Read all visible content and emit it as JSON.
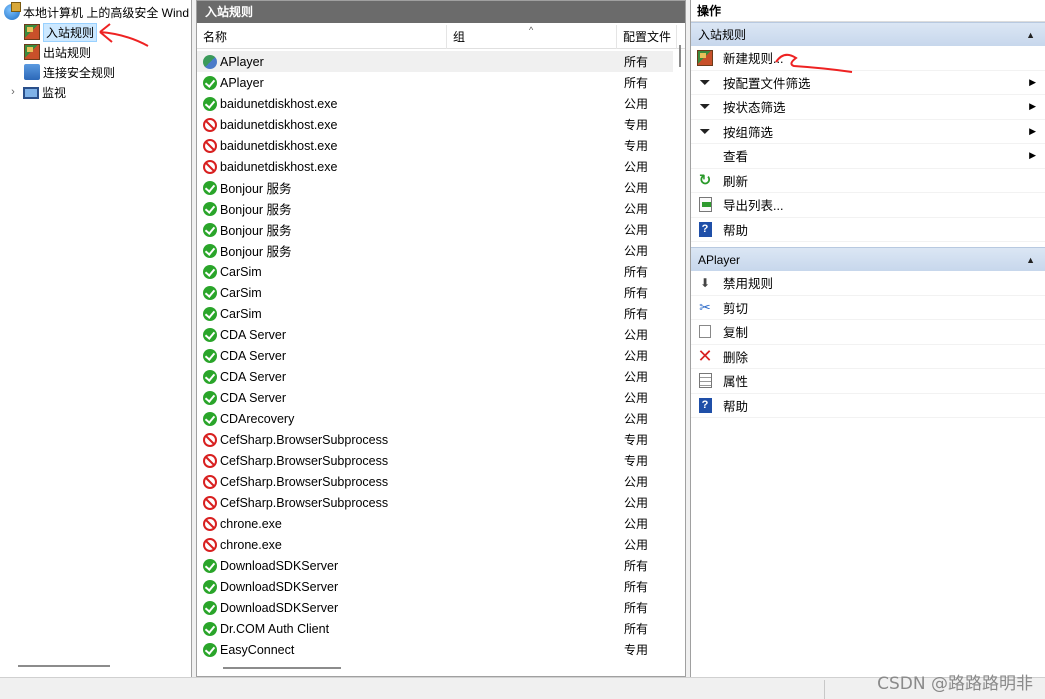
{
  "tree": {
    "root": "本地计算机 上的高级安全 Wind",
    "items": [
      {
        "label": "入站规则",
        "icon": "inbound-rules-icon",
        "selected": true
      },
      {
        "label": "出站规则",
        "icon": "outbound-rules-icon",
        "selected": false
      },
      {
        "label": "连接安全规则",
        "icon": "connection-security-icon",
        "selected": false
      },
      {
        "label": "监视",
        "icon": "monitor-icon",
        "selected": false
      }
    ]
  },
  "list": {
    "title": "入站规则",
    "columns": {
      "name": "名称",
      "group": "组",
      "profile": "配置文件"
    },
    "rows": [
      {
        "name": "APlayer",
        "profile": "所有",
        "status": "half"
      },
      {
        "name": "APlayer",
        "profile": "所有",
        "status": "ok"
      },
      {
        "name": "baidunetdiskhost.exe",
        "profile": "公用",
        "status": "ok"
      },
      {
        "name": "baidunetdiskhost.exe",
        "profile": "专用",
        "status": "block"
      },
      {
        "name": "baidunetdiskhost.exe",
        "profile": "专用",
        "status": "block"
      },
      {
        "name": "baidunetdiskhost.exe",
        "profile": "公用",
        "status": "block"
      },
      {
        "name": "Bonjour 服务",
        "profile": "公用",
        "status": "ok"
      },
      {
        "name": "Bonjour 服务",
        "profile": "公用",
        "status": "ok"
      },
      {
        "name": "Bonjour 服务",
        "profile": "公用",
        "status": "ok"
      },
      {
        "name": "Bonjour 服务",
        "profile": "公用",
        "status": "ok"
      },
      {
        "name": "CarSim",
        "profile": "所有",
        "status": "ok"
      },
      {
        "name": "CarSim",
        "profile": "所有",
        "status": "ok"
      },
      {
        "name": "CarSim",
        "profile": "所有",
        "status": "ok"
      },
      {
        "name": "CDA Server",
        "profile": "公用",
        "status": "ok"
      },
      {
        "name": "CDA Server",
        "profile": "公用",
        "status": "ok"
      },
      {
        "name": "CDA Server",
        "profile": "公用",
        "status": "ok"
      },
      {
        "name": "CDA Server",
        "profile": "公用",
        "status": "ok"
      },
      {
        "name": "CDArecovery",
        "profile": "公用",
        "status": "ok"
      },
      {
        "name": "CefSharp.BrowserSubprocess",
        "profile": "专用",
        "status": "block"
      },
      {
        "name": "CefSharp.BrowserSubprocess",
        "profile": "专用",
        "status": "block"
      },
      {
        "name": "CefSharp.BrowserSubprocess",
        "profile": "公用",
        "status": "block"
      },
      {
        "name": "CefSharp.BrowserSubprocess",
        "profile": "公用",
        "status": "block"
      },
      {
        "name": "chrone.exe",
        "profile": "公用",
        "status": "block"
      },
      {
        "name": "chrone.exe",
        "profile": "公用",
        "status": "block"
      },
      {
        "name": "DownloadSDKServer",
        "profile": "所有",
        "status": "ok"
      },
      {
        "name": "DownloadSDKServer",
        "profile": "所有",
        "status": "ok"
      },
      {
        "name": "DownloadSDKServer",
        "profile": "所有",
        "status": "ok"
      },
      {
        "name": "Dr.COM Auth Client",
        "profile": "所有",
        "status": "ok"
      },
      {
        "name": "EasyConnect",
        "profile": "专用",
        "status": "ok"
      }
    ]
  },
  "actions": {
    "title": "操作",
    "section1": {
      "title": "入站规则",
      "items": [
        {
          "label": "新建规则...",
          "icon": "new-rule-icon",
          "submenu": false
        },
        {
          "label": "按配置文件筛选",
          "icon": "filter-icon",
          "submenu": true
        },
        {
          "label": "按状态筛选",
          "icon": "filter-icon",
          "submenu": true
        },
        {
          "label": "按组筛选",
          "icon": "filter-icon",
          "submenu": true
        },
        {
          "label": "查看",
          "icon": "",
          "submenu": true
        },
        {
          "label": "刷新",
          "icon": "refresh-icon",
          "submenu": false
        },
        {
          "label": "导出列表...",
          "icon": "export-icon",
          "submenu": false
        },
        {
          "label": "帮助",
          "icon": "help-icon",
          "submenu": false
        }
      ]
    },
    "section2": {
      "title": "APlayer",
      "items": [
        {
          "label": "禁用规则",
          "icon": "disable-icon"
        },
        {
          "label": "剪切",
          "icon": "cut-icon"
        },
        {
          "label": "复制",
          "icon": "copy-icon"
        },
        {
          "label": "删除",
          "icon": "delete-icon"
        },
        {
          "label": "属性",
          "icon": "properties-icon"
        },
        {
          "label": "帮助",
          "icon": "help-icon"
        }
      ]
    }
  },
  "watermark": "CSDN @路路路明非"
}
